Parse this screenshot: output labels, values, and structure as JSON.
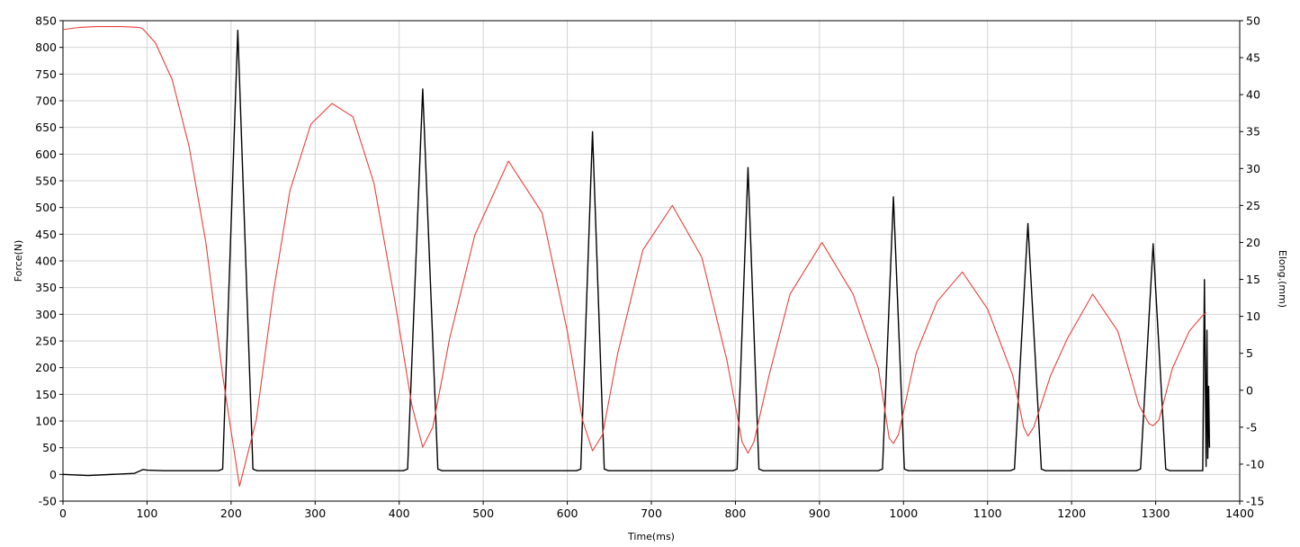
{
  "chart_data": {
    "type": "line",
    "xlabel": "Time(ms)",
    "ylabel": "Force(N)",
    "y2label": "Elong.(mm)",
    "xlim": [
      0,
      1400
    ],
    "ylim": [
      -50,
      850
    ],
    "y2lim": [
      -15,
      50
    ],
    "grid": true,
    "x_ticks": [
      0,
      100,
      200,
      300,
      400,
      500,
      600,
      700,
      800,
      900,
      1000,
      1100,
      1200,
      1300,
      1400
    ],
    "y_ticks": [
      -50,
      0,
      50,
      100,
      150,
      200,
      250,
      300,
      350,
      400,
      450,
      500,
      550,
      600,
      650,
      700,
      750,
      800,
      850
    ],
    "y2_ticks": [
      -15,
      -10,
      -5,
      0,
      5,
      10,
      15,
      20,
      25,
      30,
      35,
      40,
      45,
      50
    ],
    "series": [
      {
        "color": "#000000",
        "axis": "left",
        "baseline": 5,
        "x": [
          0,
          30,
          85,
          95,
          100,
          120,
          185,
          190,
          208,
          226,
          231,
          405,
          410,
          428,
          446,
          451,
          611,
          616,
          630,
          644,
          649,
          797,
          802,
          815,
          828,
          833,
          970,
          975,
          988,
          1001,
          1006,
          1127,
          1132,
          1148,
          1164,
          1169,
          1277,
          1282,
          1297,
          1312,
          1317,
          1356,
          1358,
          1360,
          1361,
          1362,
          1363,
          1364
        ],
        "y": [
          0,
          -2,
          2,
          9,
          8,
          7,
          7,
          10,
          832,
          10,
          7,
          7,
          10,
          722,
          10,
          7,
          7,
          10,
          642,
          10,
          7,
          7,
          10,
          575,
          10,
          7,
          7,
          10,
          520,
          10,
          7,
          7,
          10,
          470,
          10,
          7,
          7,
          10,
          432,
          10,
          7,
          7,
          365,
          15,
          270,
          30,
          165,
          50
        ]
      },
      {
        "color": "#e8403a",
        "axis": "right",
        "x": [
          0,
          20,
          40,
          70,
          90,
          95,
          110,
          130,
          150,
          170,
          190,
          210,
          230,
          250,
          270,
          295,
          320,
          345,
          370,
          395,
          415,
          428,
          440,
          460,
          490,
          530,
          570,
          600,
          618,
          630,
          642,
          660,
          690,
          725,
          760,
          790,
          808,
          815,
          822,
          840,
          865,
          903,
          940,
          970,
          983,
          988,
          994,
          1015,
          1040,
          1070,
          1100,
          1130,
          1143,
          1148,
          1155,
          1175,
          1195,
          1225,
          1255,
          1280,
          1292,
          1297,
          1304,
          1320,
          1340,
          1355,
          1360
        ],
        "y": [
          48.8,
          49.1,
          49.2,
          49.2,
          49.1,
          48.9,
          47,
          42,
          33,
          20,
          2,
          -13,
          -4,
          13,
          27,
          36,
          38.8,
          37,
          28,
          12,
          -2,
          -7.7,
          -5,
          7,
          21,
          31,
          24,
          8,
          -4,
          -8.2,
          -6,
          5,
          19,
          25,
          18,
          4,
          -7,
          -8.5,
          -7,
          2,
          13,
          20,
          13,
          3,
          -6.5,
          -7.2,
          -6,
          5,
          12,
          16,
          11,
          2,
          -5,
          -6.2,
          -5,
          2,
          7,
          13,
          8,
          -2,
          -4.5,
          -4.8,
          -4,
          3,
          8,
          10,
          10.5
        ]
      }
    ]
  }
}
